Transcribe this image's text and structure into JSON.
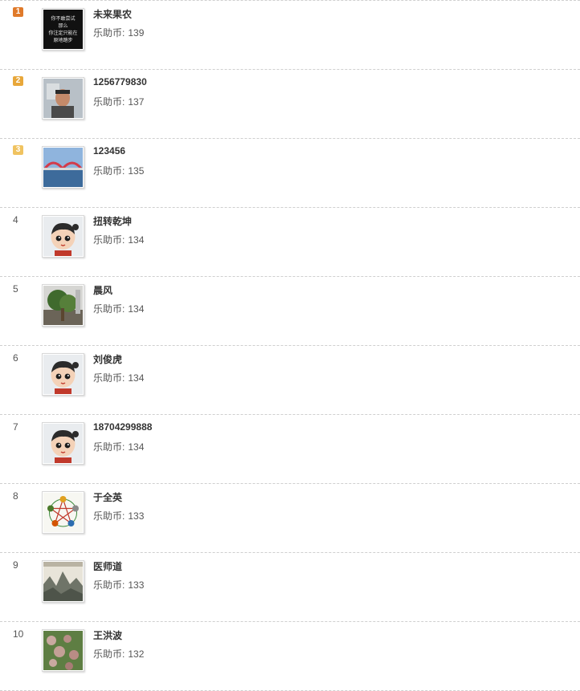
{
  "coin_label": "乐助币:",
  "badge_colors": {
    "1": "#e07a2a",
    "2": "#e8a73a",
    "3": "#f0c360"
  },
  "avatar_text_lines": [
    "你不敢尝试",
    "那么",
    "你注定只能在",
    "原地踏步"
  ],
  "rows": [
    {
      "rank": "1",
      "badge": true,
      "avatar": "quote-text-avatar",
      "name": "未来果农",
      "coins": "139"
    },
    {
      "rank": "2",
      "badge": true,
      "avatar": "man-photo-avatar",
      "name": "1256779830",
      "coins": "137"
    },
    {
      "rank": "3",
      "badge": true,
      "avatar": "bridge-photo-avatar",
      "name": "123456",
      "coins": "135"
    },
    {
      "rank": "4",
      "badge": false,
      "avatar": "default-cartoon-avatar",
      "name": "扭转乾坤",
      "coins": "134"
    },
    {
      "rank": "5",
      "badge": false,
      "avatar": "tree-photo-avatar",
      "name": "晨风",
      "coins": "134"
    },
    {
      "rank": "6",
      "badge": false,
      "avatar": "default-cartoon-avatar",
      "name": "刘俊虎",
      "coins": "134"
    },
    {
      "rank": "7",
      "badge": false,
      "avatar": "default-cartoon-avatar",
      "name": "18704299888",
      "coins": "134"
    },
    {
      "rank": "8",
      "badge": false,
      "avatar": "five-elements-avatar",
      "name": "于全英",
      "coins": "133"
    },
    {
      "rank": "9",
      "badge": false,
      "avatar": "mountain-painting-avatar",
      "name": "医师道",
      "coins": "133"
    },
    {
      "rank": "10",
      "badge": false,
      "avatar": "fruit-tree-avatar",
      "name": "王洪波",
      "coins": "132"
    }
  ]
}
